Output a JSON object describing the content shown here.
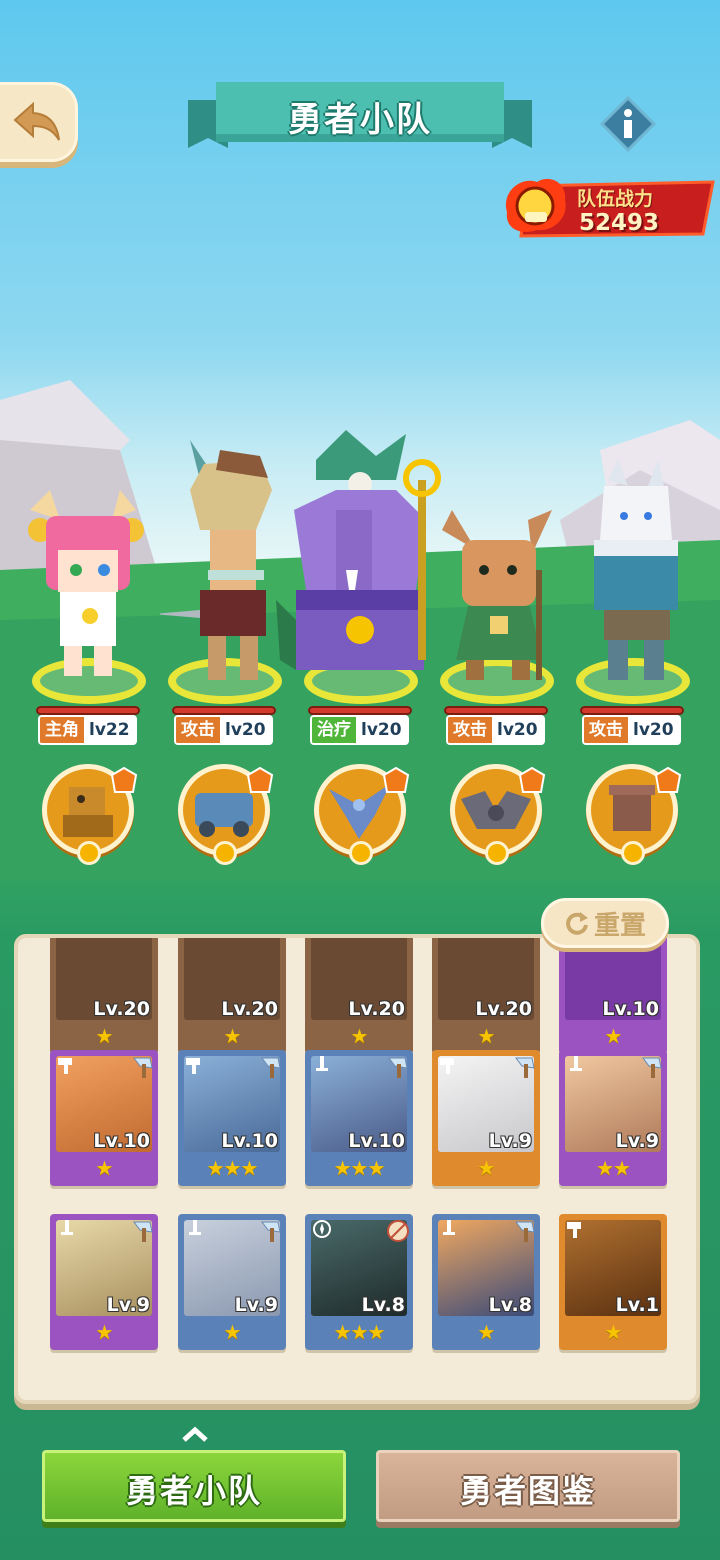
{
  "header": {
    "title": "勇者小队",
    "back_icon": "back-arrow-icon",
    "info_icon": "info-icon"
  },
  "team_power": {
    "label": "队伍战力",
    "value": "52493"
  },
  "heroes": [
    {
      "role": "主角",
      "level": "lv22",
      "hp_fraction": 1.0
    },
    {
      "role": "攻击",
      "level": "lv20",
      "hp_fraction": 1.0
    },
    {
      "role": "治疗",
      "level": "lv20",
      "hp_fraction": 1.0
    },
    {
      "role": "攻击",
      "level": "lv20",
      "hp_fraction": 1.0
    },
    {
      "role": "攻击",
      "level": "lv20",
      "hp_fraction": 1.0
    }
  ],
  "reset_button": {
    "label": "重置"
  },
  "inventory": {
    "row0": [
      {
        "level": "Lv.20",
        "stars": "★"
      },
      {
        "level": "Lv.20",
        "stars": "★"
      },
      {
        "level": "Lv.20",
        "stars": "★"
      },
      {
        "level": "Lv.20",
        "stars": "★"
      },
      {
        "level": "Lv.10",
        "stars": "★"
      }
    ],
    "row1": [
      {
        "level": "Lv.10",
        "stars": "★"
      },
      {
        "level": "Lv.10",
        "stars": "★★★"
      },
      {
        "level": "Lv.10",
        "stars": "★★★"
      },
      {
        "level": "Lv.9",
        "stars": "★"
      },
      {
        "level": "Lv.9",
        "stars": "★★"
      }
    ],
    "row2": [
      {
        "level": "Lv.9",
        "stars": "★"
      },
      {
        "level": "Lv.9",
        "stars": "★"
      },
      {
        "level": "Lv.8",
        "stars": "★★★"
      },
      {
        "level": "Lv.8",
        "stars": "★"
      },
      {
        "level": "Lv.1",
        "stars": "★"
      }
    ]
  },
  "tabs": {
    "team": "勇者小队",
    "codex": "勇者图鉴"
  },
  "colors": {
    "rarity_purple": "#9b53c2",
    "rarity_blue": "#5b82b8",
    "rarity_orange": "#e08a2e",
    "tab_active": "#6cc22e",
    "tab_inactive": "#c9a38a"
  }
}
